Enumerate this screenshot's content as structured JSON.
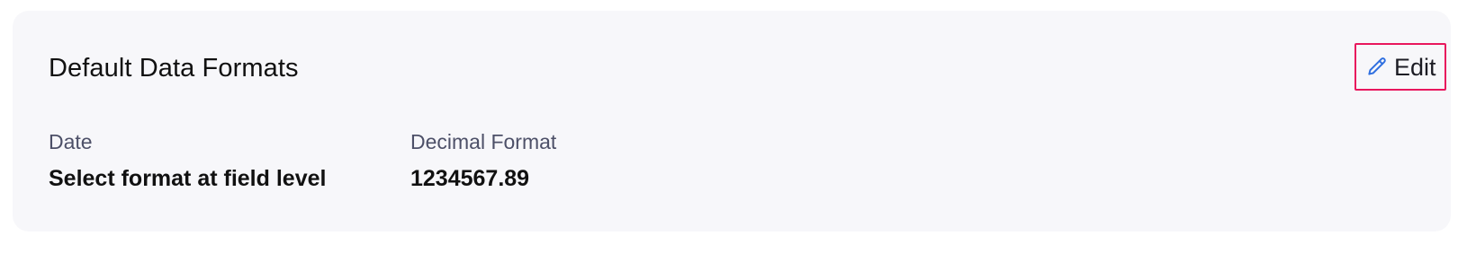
{
  "card": {
    "title": "Default Data Formats",
    "edit_label": "Edit",
    "edit_icon": "pencil-icon",
    "highlight_color": "#e8175d",
    "icon_color": "#2f6fe0",
    "fields": [
      {
        "label": "Date",
        "value": "Select format at field level"
      },
      {
        "label": "Decimal Format",
        "value": "1234567.89"
      }
    ]
  }
}
